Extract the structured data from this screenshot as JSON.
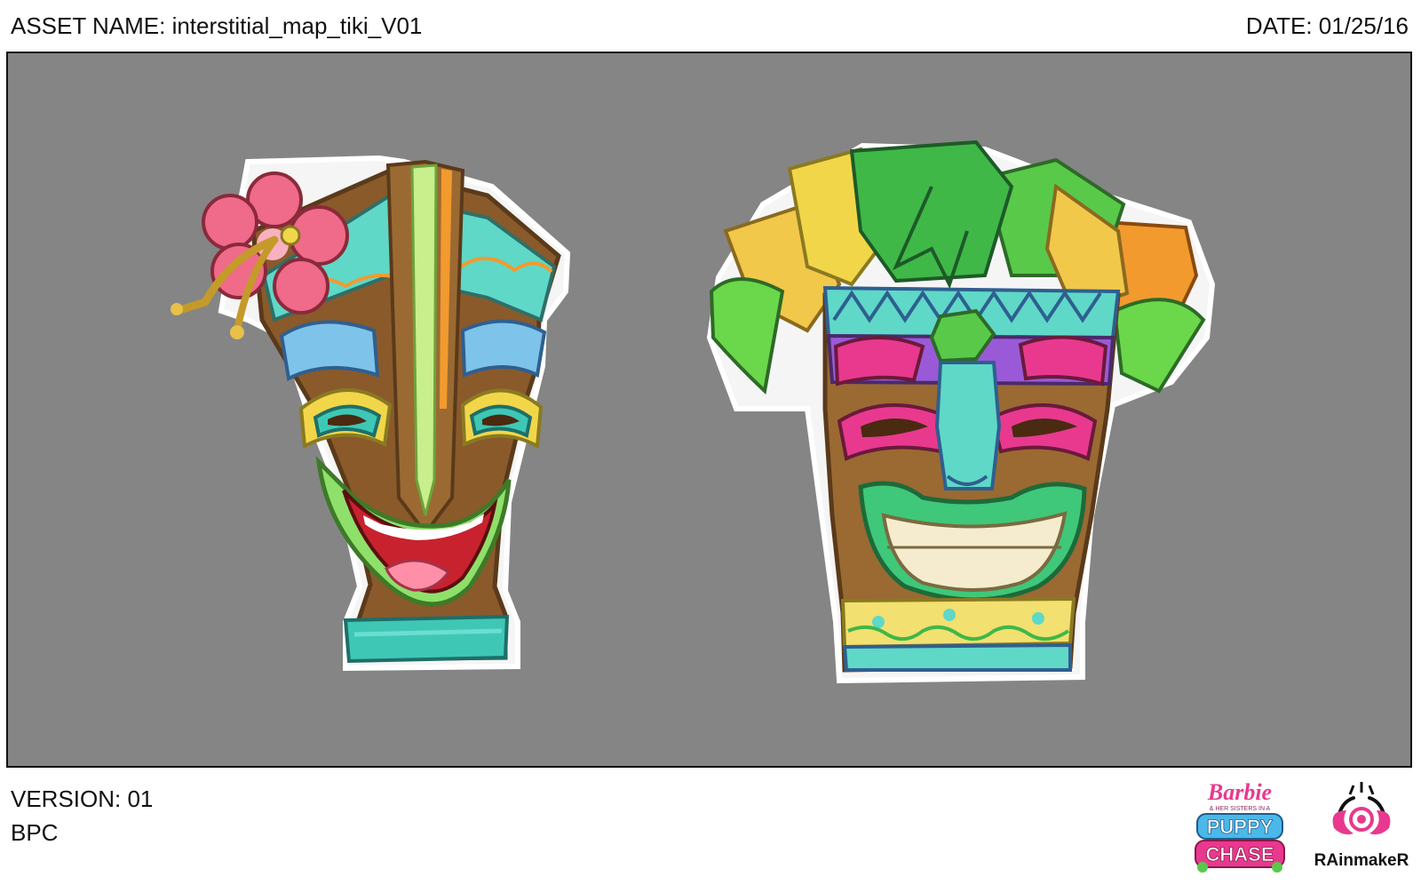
{
  "header": {
    "asset_name": "ASSET NAME: interstitial_map_tiki_V01",
    "date": "DATE: 01/25/16"
  },
  "footer": {
    "version": "VERSION: 01",
    "code": "BPC"
  },
  "logos": {
    "barbie": {
      "line1": "Barbie",
      "line2": "& HER SISTERS IN A",
      "line3": "PUPPY",
      "line4": "CHASE"
    },
    "rainmaker": {
      "text": "RAinmakeR"
    }
  },
  "colors": {
    "canvas": "#858585",
    "wood": "#8a5a2b",
    "outline": "#5a3a1a",
    "teal": "#3fc7b5",
    "green": "#59c94a",
    "pink": "#e8398f",
    "yellow": "#f2d64a",
    "orange": "#f29a2e",
    "blue": "#5aa8e0",
    "purple": "#9a5ad8"
  }
}
